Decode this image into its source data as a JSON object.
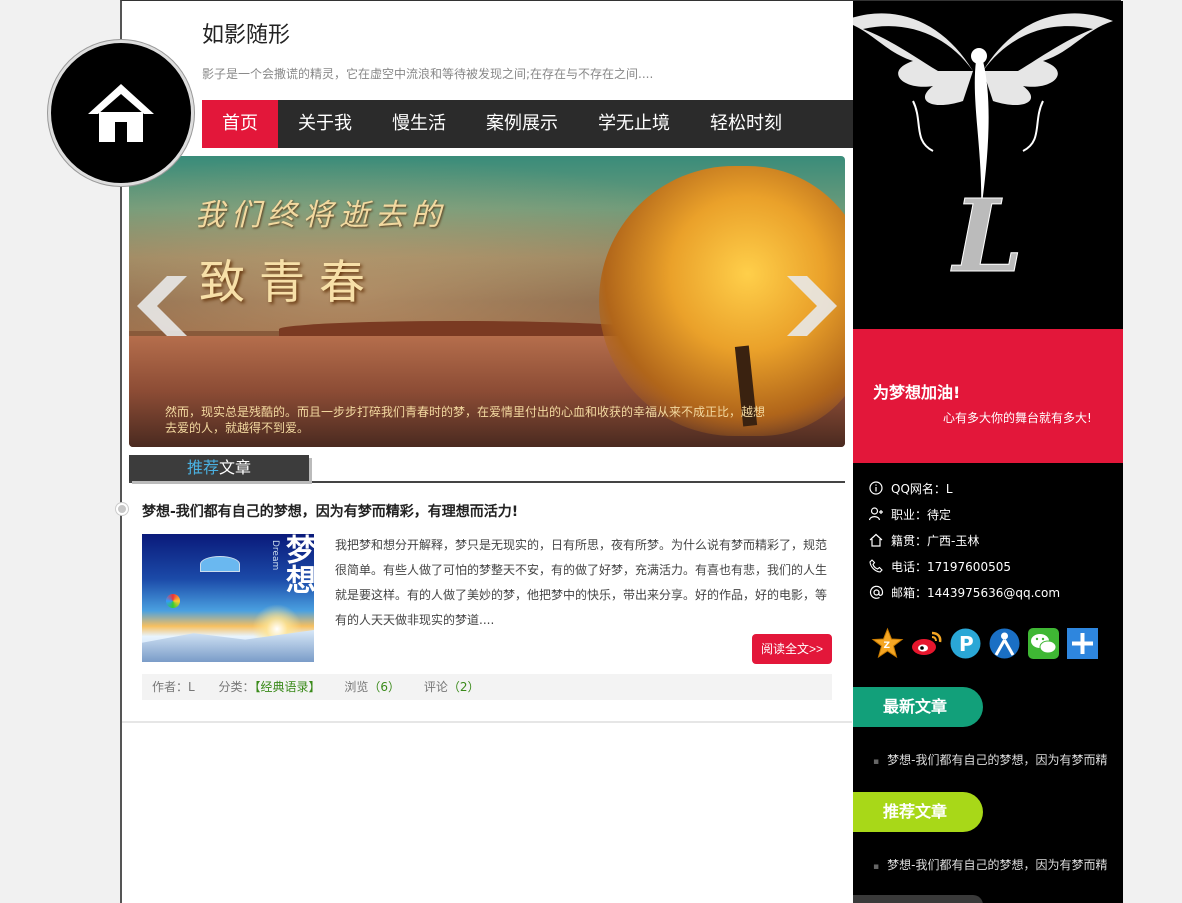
{
  "header": {
    "site_title": "如影随形",
    "site_desc": "影子是一个会撒谎的精灵，它在虚空中流浪和等待被发现之间;在存在与不存在之间...."
  },
  "nav": {
    "items": [
      {
        "label": "首页",
        "active": true
      },
      {
        "label": "关于我"
      },
      {
        "label": "慢生活"
      },
      {
        "label": "案例展示"
      },
      {
        "label": "学无止境"
      },
      {
        "label": "轻松时刻"
      }
    ]
  },
  "banner": {
    "line1": "我们终将逝去的",
    "line2": "致青春",
    "caption": "然而，现实总是残酷的。而且一步步打碎我们青春时的梦，在爱情里付出的心血和收获的幸福从来不成正比，越想去爱的人，就越得不到爱。"
  },
  "section": {
    "heading_highlight": "推荐",
    "heading_rest": "文章"
  },
  "article": {
    "title": "梦想-我们都有自己的梦想，因为有梦而精彩，有理想而活力!",
    "image_text_cn": "梦想",
    "image_text_en": "Dream",
    "body": "我把梦和想分开解释，梦只是无现实的，日有所思，夜有所梦。为什么说有梦而精彩了，规范很简单。有些人做了可怕的梦整天不安，有的做了好梦，充满活力。有喜也有悲，我们的人生就是要这样。有的人做了美妙的梦，他把梦中的快乐，带出来分享。好的作品，好的电影，等有的人天天做非现实的梦道....",
    "read_more": "阅读全文>>",
    "meta": {
      "author_label": "作者：",
      "author": "L",
      "category_label": "分类：",
      "category": "【经典语录】",
      "views_label": "浏览",
      "views": "（6）",
      "comments_label": "评论",
      "comments": "（2）"
    }
  },
  "sidebar": {
    "slogan_title": "为梦想加油!",
    "slogan_sub": "心有多大你的舞台就有多大!",
    "info": [
      {
        "icon": "info-icon",
        "text": "QQ网名：L"
      },
      {
        "icon": "user-icon",
        "text": "职业：待定"
      },
      {
        "icon": "home-icon",
        "text": "籍贯：广西-玉林"
      },
      {
        "icon": "phone-icon",
        "text": "电话：17197600505"
      },
      {
        "icon": "at-icon",
        "text": "邮箱：1443975636@qq.com"
      }
    ],
    "socials": [
      "qzone-icon",
      "weibo-icon",
      "pengyou-icon",
      "renren-icon",
      "wechat-icon",
      "share-plus-icon"
    ],
    "latest_label": "最新文章",
    "latest_item": "梦想-我们都有自己的梦想，因为有梦而精",
    "recommend_label": "推荐文章",
    "recommend_item": "梦想-我们都有自己的梦想，因为有梦而精"
  },
  "colors": {
    "accent": "#e3173a",
    "nav_bg": "#2b2b2b",
    "latest_pill": "#12a07a",
    "recommend_pill": "#a8d818"
  }
}
